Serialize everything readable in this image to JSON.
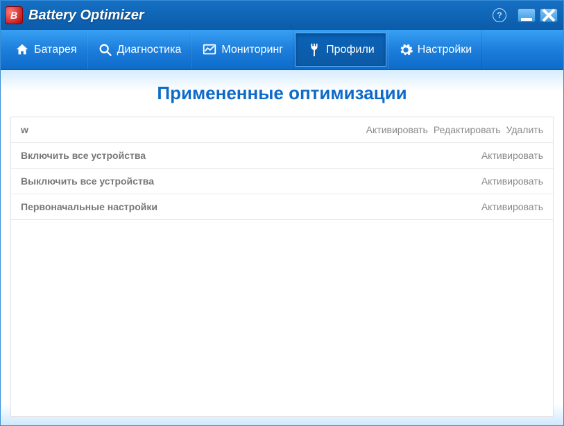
{
  "titlebar": {
    "app_name": "Battery Optimizer",
    "logo_text": "B"
  },
  "nav": {
    "battery": "Батарея",
    "diagnostics": "Диагностика",
    "monitoring": "Мониторинг",
    "profiles": "Профили",
    "settings": "Настройки"
  },
  "page": {
    "heading": "Примененные оптимизации"
  },
  "table": {
    "rows": [
      {
        "name": "w",
        "activate": "Активировать",
        "edit": "Редактировать",
        "del": "Удалить"
      },
      {
        "name": "Включить все устройства",
        "activate": "Активировать",
        "edit": "",
        "del": ""
      },
      {
        "name": "Выключить все устройства",
        "activate": "Активировать",
        "edit": "",
        "del": ""
      },
      {
        "name": "Первоначальные настройки",
        "activate": "Активировать",
        "edit": "",
        "del": ""
      }
    ]
  }
}
